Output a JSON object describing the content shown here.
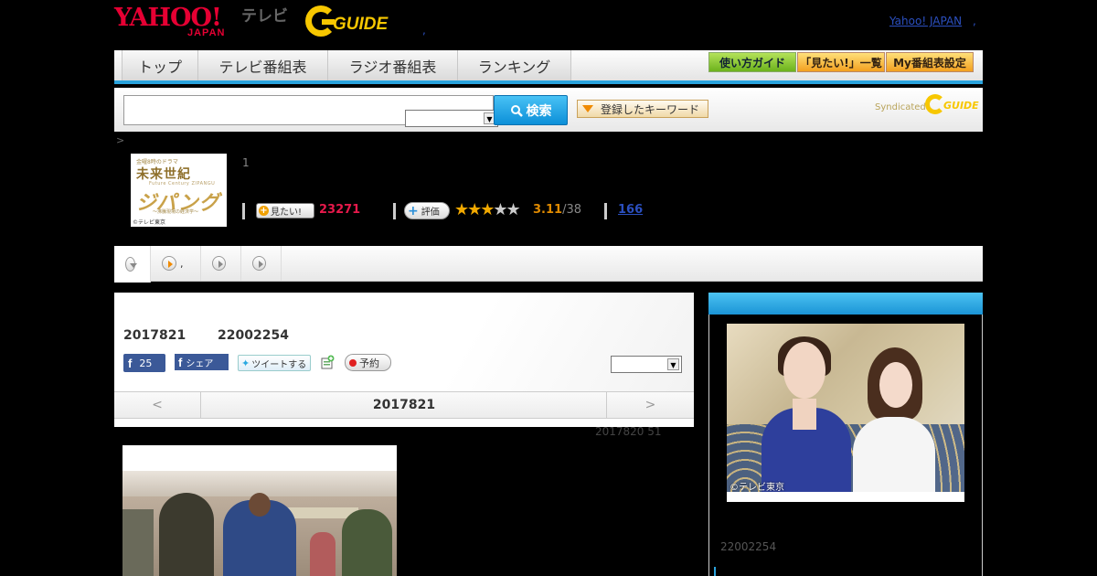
{
  "header": {
    "yahoo_logo_top": "YAHOO!",
    "yahoo_logo_bottom": "JAPAN",
    "tv_label": "テレビ",
    "gguide_logo": "GUIDE",
    "dot": ",",
    "yahoo_japan_link": "Yahoo! JAPAN",
    "link_arrow": ","
  },
  "nav": {
    "tabs": [
      {
        "label": "トップ",
        "width": 84
      },
      {
        "label": "テレビ番組表",
        "width": 142
      },
      {
        "label": "ラジオ番組表",
        "width": 142
      },
      {
        "label": "ランキング",
        "width": 124
      }
    ],
    "buttons": [
      {
        "label": "使い方ガイド",
        "style": "green"
      },
      {
        "label": "「見たい!」一覧",
        "style": "orange"
      },
      {
        "label": "My番組表設定",
        "style": "orange"
      }
    ]
  },
  "search": {
    "input_value": "",
    "select_value": "",
    "button_label": "検索",
    "keyword_button": "登録したキーワード",
    "syndicated_label": "Syndicated",
    "syndicated_logo": "GUIDE"
  },
  "breadcrumb": ">",
  "program": {
    "thumb_small": "金曜8時のドラマ",
    "thumb_title": "未来世紀",
    "thumb_sub": "Future Century ZIPANGU",
    "thumb_logo": "ジパング",
    "thumb_caption": "〜沸騰現場の経済学〜",
    "thumb_copyright": "©テレビ東京",
    "number": "1",
    "mitai_button": "見たい!",
    "mitai_count": "23271",
    "hyoka_button": "評価",
    "stars_on": "★★★",
    "stars_off": "★★",
    "score": "3.11",
    "score_of": "/38",
    "review_count": "166"
  },
  "subtabs": [
    {
      "label": "",
      "icon": "chevron-down-icon",
      "active": true
    },
    {
      "label": ",",
      "icon": "play-orange-icon",
      "active": false
    },
    {
      "label": "",
      "icon": "play-icon",
      "active": false
    },
    {
      "label": "",
      "icon": "play-icon",
      "active": false
    }
  ],
  "main": {
    "date": "2017821",
    "id": "22002254",
    "fb_count": "25",
    "fb_share": "シェア",
    "tweet": "ツイートする",
    "yoyaku": "予約",
    "select_value": "",
    "pager_prev": "<",
    "pager_current": "2017821",
    "pager_next": ">",
    "posted": "2017820  51"
  },
  "side": {
    "photo_copyright": "©テレビ東京",
    "id": "22002254"
  },
  "colors": {
    "accent_blue": "#2aa3dd",
    "yahoo_red": "#e60033",
    "gguide_yellow": "#f7c700",
    "star_orange": "#f2a900",
    "mitai_pink": "#e6194b"
  }
}
